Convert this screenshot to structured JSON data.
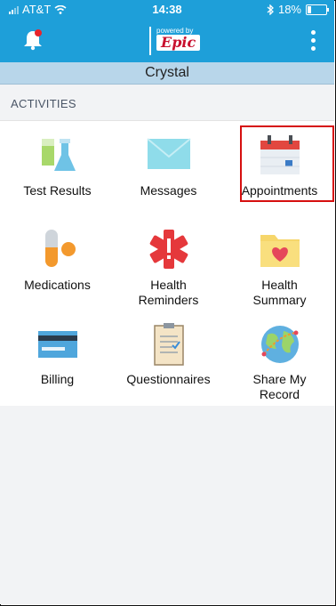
{
  "status_bar": {
    "carrier": "AT&T",
    "time": "14:38",
    "battery": "18%"
  },
  "app_bar": {
    "logo_powered": "powered by",
    "logo_brand": "Epic"
  },
  "patient_name": "Crystal",
  "section_title": "ACTIVITIES",
  "activities": [
    {
      "label": "Test Results",
      "icon": "test-tubes-icon"
    },
    {
      "label": "Messages",
      "icon": "envelope-icon"
    },
    {
      "label": "Appointments",
      "icon": "calendar-icon"
    },
    {
      "label": "Medications",
      "icon": "pill-icon"
    },
    {
      "label": "Health\nReminders",
      "icon": "medical-star-icon"
    },
    {
      "label": "Health\nSummary",
      "icon": "heart-folder-icon"
    },
    {
      "label": "Billing",
      "icon": "credit-card-icon"
    },
    {
      "label": "Questionnaires",
      "icon": "clipboard-icon"
    },
    {
      "label": "Share My\nRecord",
      "icon": "globe-share-icon"
    }
  ],
  "colors": {
    "brand_blue": "#1e9fd9",
    "name_bar": "#b8d6ea",
    "highlight": "#d60f0f"
  }
}
